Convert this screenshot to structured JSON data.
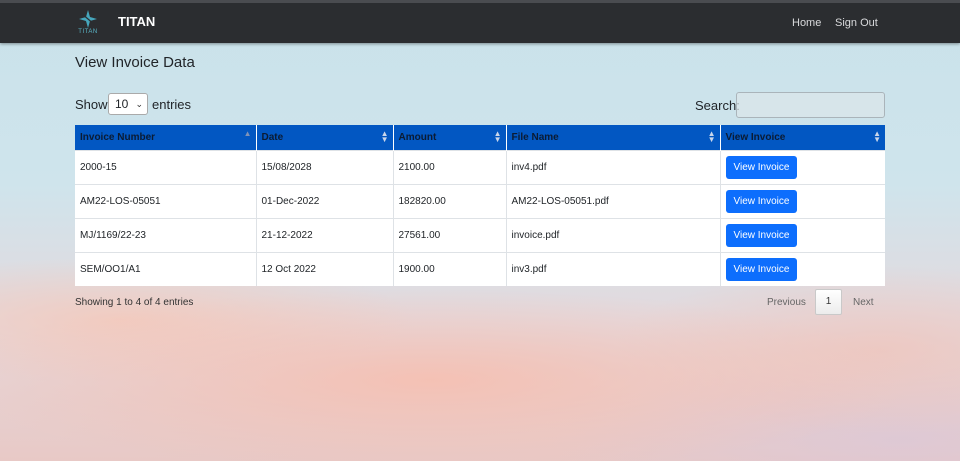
{
  "nav": {
    "logo_text": "TITAN",
    "brand": "TITAN",
    "links": [
      "Home",
      "Sign Out"
    ]
  },
  "page": {
    "title": "View Invoice Data"
  },
  "length": {
    "show_label": "Show",
    "value": "10",
    "entries_label": "entries"
  },
  "search": {
    "label": "Search:",
    "value": ""
  },
  "table": {
    "columns": [
      "Invoice Number",
      "Date",
      "Amount",
      "File Name",
      "View Invoice"
    ],
    "rows": [
      {
        "invoice_number": "2000-15",
        "date": "15/08/2028",
        "amount": "2100.00",
        "file_name": "inv4.pdf",
        "action": "View Invoice"
      },
      {
        "invoice_number": "AM22-LOS-05051",
        "date": "01-Dec-2022",
        "amount": "182820.00",
        "file_name": "AM22-LOS-05051.pdf",
        "action": "View Invoice"
      },
      {
        "invoice_number": "MJ/1169/22-23",
        "date": "21-12-2022",
        "amount": "27561.00",
        "file_name": "invoice.pdf",
        "action": "View Invoice"
      },
      {
        "invoice_number": "SEM/OO1/A1",
        "date": "12 Oct 2022",
        "amount": "1900.00",
        "file_name": "inv3.pdf",
        "action": "View Invoice"
      }
    ]
  },
  "footer": {
    "info": "Showing 1 to 4 of 4 entries",
    "previous": "Previous",
    "page": "1",
    "next": "Next"
  },
  "colors": {
    "navbar": "#2b2d30",
    "header_bg": "#0257c2",
    "button_bg": "#0d6efd"
  }
}
